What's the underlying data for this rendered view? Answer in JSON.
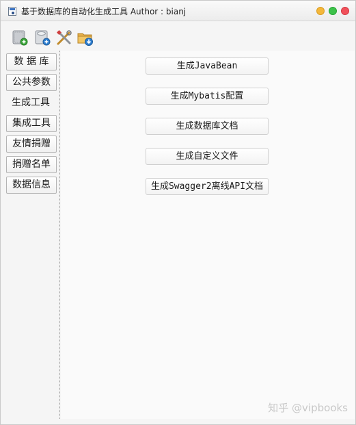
{
  "window": {
    "title": "基于数据库的自动化生成工具  Author : bianj"
  },
  "toolbar": {
    "buttons": [
      {
        "icon": "database-add-icon"
      },
      {
        "icon": "database-connect-icon"
      },
      {
        "icon": "tools-icon"
      },
      {
        "icon": "folder-download-icon"
      }
    ]
  },
  "sidebar": {
    "items": [
      {
        "label": "数 据 库"
      },
      {
        "label": "公共参数"
      },
      {
        "label": "生成工具",
        "active": true
      },
      {
        "label": "集成工具"
      },
      {
        "label": "友情捐赠"
      },
      {
        "label": "捐赠名单"
      },
      {
        "label": "数据信息"
      }
    ]
  },
  "actions": {
    "buttons": [
      {
        "label": "生成JavaBean"
      },
      {
        "label": "生成Mybatis配置"
      },
      {
        "label": "生成数据库文档"
      },
      {
        "label": "生成自定义文件"
      },
      {
        "label": "生成Swagger2离线API文档"
      }
    ]
  },
  "watermark": {
    "text": "知乎 @vipbooks"
  },
  "colors": {
    "minimize": "#f4b73a",
    "maximize": "#3cc24a",
    "close": "#f0505a"
  }
}
